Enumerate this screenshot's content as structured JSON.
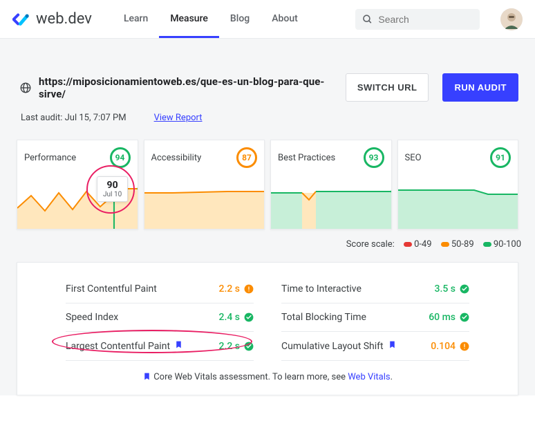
{
  "header": {
    "brand": "web.dev",
    "nav": [
      "Learn",
      "Measure",
      "Blog",
      "About"
    ],
    "activeNav": 1,
    "searchPlaceholder": "Search"
  },
  "audit": {
    "url": "https://miposicionamientoweb.es/que-es-un-blog-para-que-sirve/",
    "switchLabel": "SWITCH URL",
    "runLabel": "RUN AUDIT",
    "lastAudit": "Last audit: Jul 15, 7:07 PM",
    "viewReport": "View Report"
  },
  "cards": [
    {
      "title": "Performance",
      "score": 94,
      "color": "green",
      "tooltip": {
        "score": 90,
        "date": "Jul 10"
      }
    },
    {
      "title": "Accessibility",
      "score": 87,
      "color": "orange"
    },
    {
      "title": "Best Practices",
      "score": 93,
      "color": "green"
    },
    {
      "title": "SEO",
      "score": 91,
      "color": "green"
    }
  ],
  "scale": {
    "label": "Score scale:",
    "r": "0-49",
    "o": "50-89",
    "g": "90-100"
  },
  "metrics": {
    "left": [
      {
        "name": "First Contentful Paint",
        "value": "2.2 s",
        "status": "warn",
        "cwv": false
      },
      {
        "name": "Speed Index",
        "value": "2.4 s",
        "status": "pass",
        "cwv": false
      },
      {
        "name": "Largest Contentful Paint",
        "value": "2.2 s",
        "status": "pass",
        "cwv": true
      }
    ],
    "right": [
      {
        "name": "Time to Interactive",
        "value": "3.5 s",
        "status": "pass",
        "cwv": false
      },
      {
        "name": "Total Blocking Time",
        "value": "60 ms",
        "status": "pass",
        "cwv": false
      },
      {
        "name": "Cumulative Layout Shift",
        "value": "0.104",
        "status": "warn",
        "cwv": true
      }
    ],
    "note_a": "Core Web Vitals assessment. To learn more, see ",
    "note_link": "Web Vitals",
    "note_b": "."
  },
  "colors": {
    "green": "#18b663",
    "orange": "#fb8c00",
    "accent": "#3740ff",
    "pink": "#e91e63"
  },
  "chart_data": [
    {
      "type": "line",
      "title": "Performance",
      "ylim": [
        60,
        100
      ],
      "values": [
        75,
        88,
        70,
        90,
        75,
        92,
        78,
        90,
        94
      ],
      "color": "#fb8c00",
      "marker": {
        "x": 7,
        "label": "Jul 10",
        "value": 90
      }
    },
    {
      "type": "line",
      "title": "Accessibility",
      "ylim": [
        60,
        100
      ],
      "values": [
        86,
        87,
        86,
        87,
        87,
        87,
        87,
        87,
        87
      ],
      "color": "#fb8c00"
    },
    {
      "type": "line",
      "title": "Best Practices",
      "ylim": [
        60,
        100
      ],
      "values": [
        93,
        93,
        88,
        93,
        93,
        93,
        93,
        93,
        93
      ],
      "color": "#18b663",
      "dipColor": "#fb8c00"
    },
    {
      "type": "line",
      "title": "SEO",
      "ylim": [
        60,
        100
      ],
      "values": [
        93,
        93,
        93,
        93,
        93,
        91,
        91,
        91,
        91
      ],
      "color": "#18b663"
    }
  ]
}
